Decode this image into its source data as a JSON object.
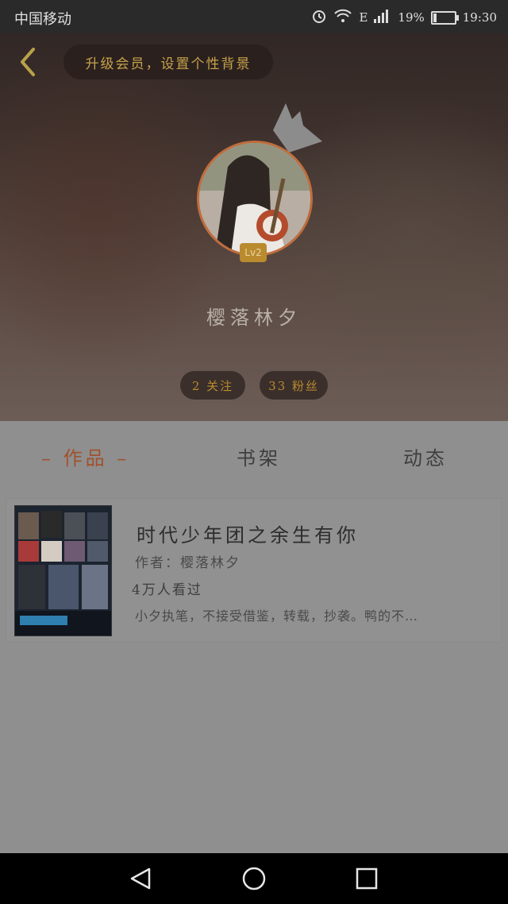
{
  "status_bar": {
    "carrier": "中国移动",
    "battery": "19%",
    "battery_level": 0.19,
    "time": "19:30",
    "network": "E"
  },
  "header": {
    "banner": "升级会员，设置个性背景",
    "username": "樱落林夕",
    "level": "Lv2",
    "fans": "2 关注",
    "follows": "33 粉丝"
  },
  "tabs": {
    "works": "– 作品 –",
    "shelf": "书架",
    "feed": "动态"
  },
  "book": {
    "title": "时代少年团之余生有你",
    "author": "作者：樱落林夕",
    "readers": "4万人看过",
    "summary": "小夕执笔，不接受借鉴，转载，抄袭。鸭的不…"
  },
  "colors": {
    "accent": "#c7a24a",
    "active_tab": "#a0522d",
    "avatar_ring": "#c06d3c"
  }
}
